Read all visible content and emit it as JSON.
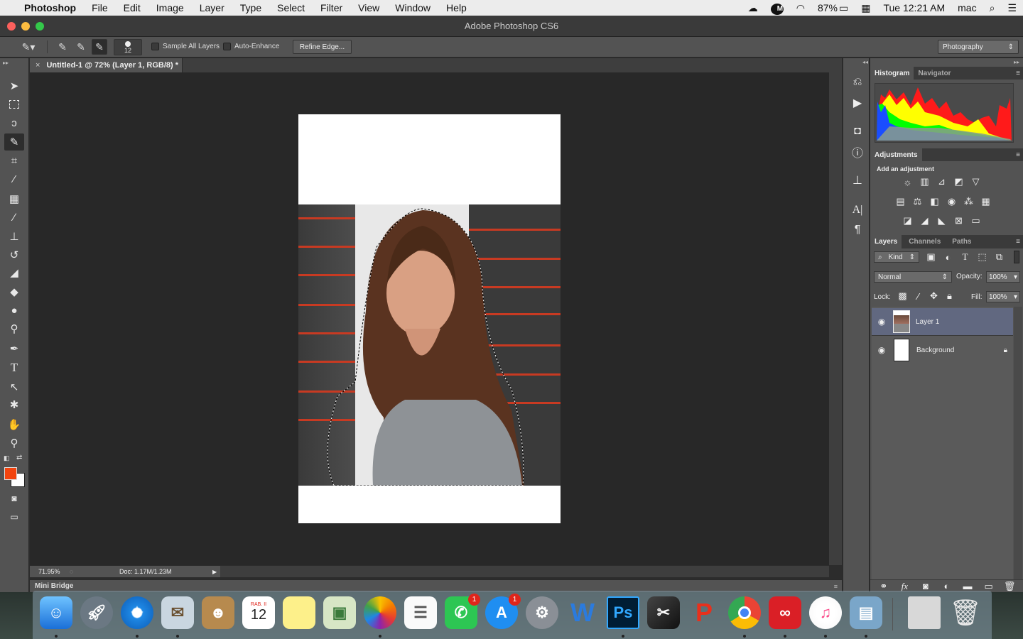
{
  "menubar": {
    "apple": "",
    "app": "Photoshop",
    "items": [
      "File",
      "Edit",
      "Image",
      "Layer",
      "Type",
      "Select",
      "Filter",
      "View",
      "Window",
      "Help"
    ],
    "battery": "87%",
    "clock": "Tue 12:21 AM",
    "user": "mac"
  },
  "window": {
    "title": "Adobe Photoshop CS6"
  },
  "options": {
    "brush_size": "12",
    "sample_all": "Sample All Layers",
    "auto_enhance": "Auto-Enhance",
    "refine_edge": "Refine Edge...",
    "workspace": "Photography"
  },
  "document": {
    "tab_title": "Untitled-1 @ 72% (Layer 1, RGB/8) *",
    "zoom": "71.95%",
    "doc_size": "Doc: 1.17M/1.23M"
  },
  "mini_bridge": "Mini Bridge",
  "histogram_panel": {
    "tabs": [
      "Histogram",
      "Navigator"
    ]
  },
  "adjustments_panel": {
    "tab": "Adjustments",
    "heading": "Add an adjustment"
  },
  "layers_panel": {
    "tabs": [
      "Layers",
      "Channels",
      "Paths"
    ],
    "kind": "Kind",
    "blend_mode": "Normal",
    "opacity_label": "Opacity:",
    "opacity": "100%",
    "lock_label": "Lock:",
    "fill_label": "Fill:",
    "fill": "100%",
    "layers": [
      {
        "name": "Layer 1"
      },
      {
        "name": "Background"
      }
    ]
  },
  "dock": {
    "calendar_month": "RAB. II",
    "calendar_day": "12",
    "facetime_badge": "1",
    "appstore_badge": "1"
  }
}
